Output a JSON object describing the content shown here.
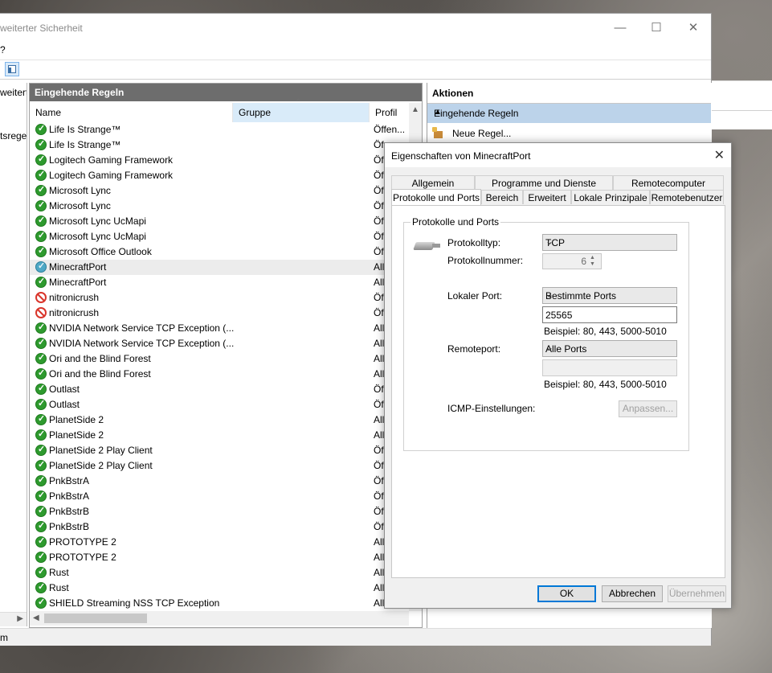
{
  "main_window": {
    "title": "weiterter Sicherheit",
    "menu": "?",
    "controls": {
      "minimize": "—",
      "maximize": "☐",
      "close": "✕"
    }
  },
  "tree": {
    "item1": "weitert",
    "item2": "tsrege"
  },
  "rules_pane": {
    "title": "Eingehende Regeln",
    "columns": {
      "name": "Name",
      "group": "Gruppe",
      "profile": "Profil"
    },
    "rows": [
      {
        "name": "Life Is Strange™",
        "profile": "Öffen...",
        "status": "allow"
      },
      {
        "name": "Life Is Strange™",
        "profile": "Öf",
        "status": "allow"
      },
      {
        "name": "Logitech Gaming Framework",
        "profile": "Öf",
        "status": "allow"
      },
      {
        "name": "Logitech Gaming Framework",
        "profile": "Öf",
        "status": "allow"
      },
      {
        "name": "Microsoft Lync",
        "profile": "Öf",
        "status": "allow"
      },
      {
        "name": "Microsoft Lync",
        "profile": "Öf",
        "status": "allow"
      },
      {
        "name": "Microsoft Lync UcMapi",
        "profile": "Öf",
        "status": "allow"
      },
      {
        "name": "Microsoft Lync UcMapi",
        "profile": "Öf",
        "status": "allow"
      },
      {
        "name": "Microsoft Office Outlook",
        "profile": "Öf",
        "status": "allow"
      },
      {
        "name": "MinecraftPort",
        "profile": "All",
        "status": "selected"
      },
      {
        "name": "MinecraftPort",
        "profile": "All",
        "status": "allow"
      },
      {
        "name": "nitronicrush",
        "profile": "Öf",
        "status": "block"
      },
      {
        "name": "nitronicrush",
        "profile": "Öf",
        "status": "block"
      },
      {
        "name": "NVIDIA Network Service TCP Exception (...",
        "profile": "All",
        "status": "allow"
      },
      {
        "name": "NVIDIA Network Service TCP Exception (...",
        "profile": "All",
        "status": "allow"
      },
      {
        "name": "Ori and the Blind Forest",
        "profile": "All",
        "status": "allow"
      },
      {
        "name": "Ori and the Blind Forest",
        "profile": "All",
        "status": "allow"
      },
      {
        "name": "Outlast",
        "profile": "Öf",
        "status": "allow"
      },
      {
        "name": "Outlast",
        "profile": "Öf",
        "status": "allow"
      },
      {
        "name": "PlanetSide 2",
        "profile": "All",
        "status": "allow"
      },
      {
        "name": "PlanetSide 2",
        "profile": "All",
        "status": "allow"
      },
      {
        "name": "PlanetSide 2 Play Client",
        "profile": "Öf",
        "status": "allow"
      },
      {
        "name": "PlanetSide 2 Play Client",
        "profile": "Öf",
        "status": "allow"
      },
      {
        "name": "PnkBstrA",
        "profile": "Öf",
        "status": "allow"
      },
      {
        "name": "PnkBstrA",
        "profile": "Öf",
        "status": "allow"
      },
      {
        "name": "PnkBstrB",
        "profile": "Öf",
        "status": "allow"
      },
      {
        "name": "PnkBstrB",
        "profile": "Öf",
        "status": "allow"
      },
      {
        "name": "PROTOTYPE 2",
        "profile": "All",
        "status": "allow"
      },
      {
        "name": "PROTOTYPE 2",
        "profile": "All",
        "status": "allow"
      },
      {
        "name": "Rust",
        "profile": "All",
        "status": "allow"
      },
      {
        "name": "Rust",
        "profile": "All",
        "status": "allow"
      },
      {
        "name": "SHIELD Streaming NSS TCP Exception",
        "profile": "All",
        "status": "allow"
      }
    ]
  },
  "actions_pane": {
    "title": "Aktionen",
    "section": "Eingehende Regeln",
    "items": [
      {
        "label": "Neue Regel..."
      }
    ]
  },
  "status_bar": {
    "text": "m"
  },
  "dialog": {
    "title": "Eigenschaften von MinecraftPort",
    "tabs_row1": [
      "Allgemein",
      "Programme und Dienste",
      "Remotecomputer"
    ],
    "tabs_row2": [
      "Protokolle und Ports",
      "Bereich",
      "Erweitert",
      "Lokale Prinzipale",
      "Remotebenutzer"
    ],
    "active_tab": "Protokolle und Ports",
    "group_title": "Protokolle und Ports",
    "protocol_type_label": "Protokolltyp:",
    "protocol_type_value": "TCP",
    "protocol_number_label": "Protokollnummer:",
    "protocol_number_value": "6",
    "local_port_label": "Lokaler Port:",
    "local_port_mode": "Bestimmte Ports",
    "local_port_value": "25565",
    "local_port_example": "Beispiel: 80, 443, 5000-5010",
    "remote_port_label": "Remoteport:",
    "remote_port_mode": "Alle Ports",
    "remote_port_value": "",
    "remote_port_example": "Beispiel: 80, 443, 5000-5010",
    "icmp_label": "ICMP-Einstellungen:",
    "customize_button": "Anpassen...",
    "ok_button": "OK",
    "cancel_button": "Abbrechen",
    "apply_button": "Übernehmen"
  }
}
